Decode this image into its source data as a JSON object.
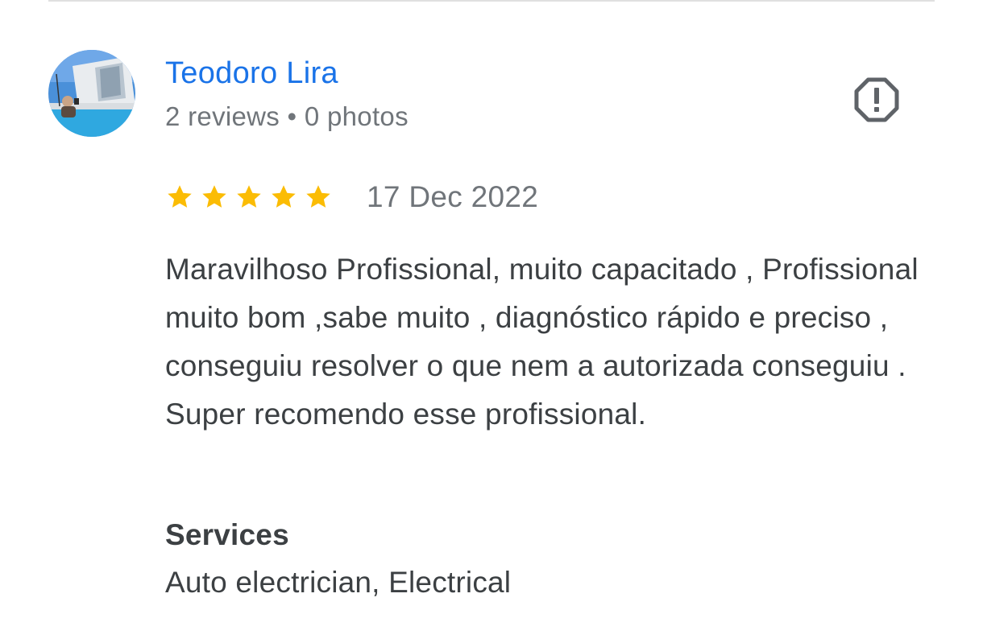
{
  "review": {
    "reviewer": {
      "name": "Teodoro Lira",
      "meta": "2 reviews • 0 photos",
      "avatar": "avatar-photo"
    },
    "report_icon": "report-flag-icon",
    "rating": {
      "stars": 5,
      "max_stars": 5,
      "star_color": "#fbbc04",
      "icon": "star-icon"
    },
    "date": "17 Dec 2022",
    "text": "Maravilhoso Profissional, muito capacitado , Profissional muito bom ,sabe muito , diagnóstico rápido e preciso , conseguiu resolver o que nem a autorizada conseguiu . Super recomendo esse profissional.",
    "services": {
      "heading": "Services",
      "value": "Auto electrician, Electrical"
    }
  },
  "colors": {
    "link": "#1a73e8",
    "secondary_text": "#70757a",
    "primary_text": "#3c4043",
    "divider": "#e0e0e0"
  }
}
